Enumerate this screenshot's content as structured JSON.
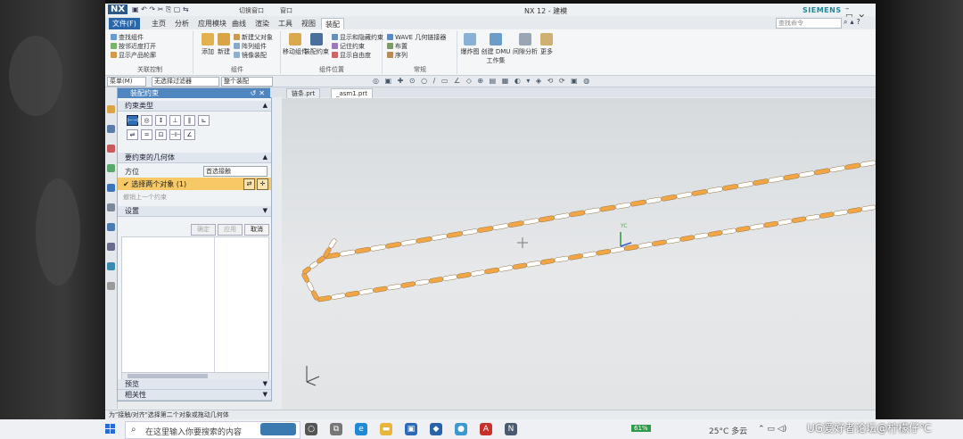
{
  "window": {
    "logo": "NX",
    "switch_window": "切换窗口",
    "window_menu": "窗口",
    "title": "NX 12 - 建模",
    "brand": "SIEMENS"
  },
  "menu": {
    "tabs": [
      "文件(F)",
      "主页",
      "分析",
      "应用模块",
      "曲线",
      "渲染",
      "工具",
      "视图",
      "装配"
    ],
    "search_placeholder": "查找命令"
  },
  "ribbon": {
    "relations": {
      "items": [
        "查找组件",
        "按邻近度打开",
        "显示产品轮廓"
      ],
      "title": "关联控制"
    },
    "components": {
      "add": "添加",
      "new": "新建",
      "items": [
        "新建父对象",
        "阵列组件",
        "镜像装配"
      ],
      "title": "组件"
    },
    "position": {
      "move": "移动组件",
      "constraint": "装配约束",
      "items": [
        "显示和隐藏约束",
        "记住约束",
        "显示自由度"
      ],
      "title": "组件位置"
    },
    "general": {
      "items": [
        "WAVE 几何链接器",
        "布置",
        "序列"
      ],
      "title": "常规"
    },
    "more": [
      "爆炸图",
      "创建 DMU 工作集",
      "间隙分析",
      "更多"
    ]
  },
  "toolbar": {
    "menu": "菜单(M)",
    "filter": "无选择过滤器",
    "scope": "整个装配"
  },
  "dialog": {
    "title": "装配约束",
    "constraint_type": "约束类型",
    "geometry_section": "要约束的几何体",
    "orientation_label": "方位",
    "orientation_value": "首选接触",
    "select_objects": "✔ 选择两个对象 (1)",
    "undo_last": "撤销上一个约束",
    "settings": "设置",
    "ok": "确定",
    "apply": "应用",
    "cancel": "取消",
    "preview": "预览",
    "relations": "相关性"
  },
  "graphics": {
    "tabs": [
      "链条.prt",
      "_asm1.prt"
    ],
    "yc": "YC"
  },
  "status": {
    "message": "为\"接触/对齐\"选择第二个对象或拖动几何体"
  },
  "taskbar": {
    "search_placeholder": "在这里输入你要搜索的内容",
    "battery": "61%",
    "weather": "25°C 多云"
  },
  "watermark": "UG爱好者论坛@柠檬仔℃",
  "colors": {
    "accent": "#2b67a8",
    "chain_pin": "#f2a544",
    "chain_link": "#ffffff",
    "selection": "#f7c866"
  }
}
